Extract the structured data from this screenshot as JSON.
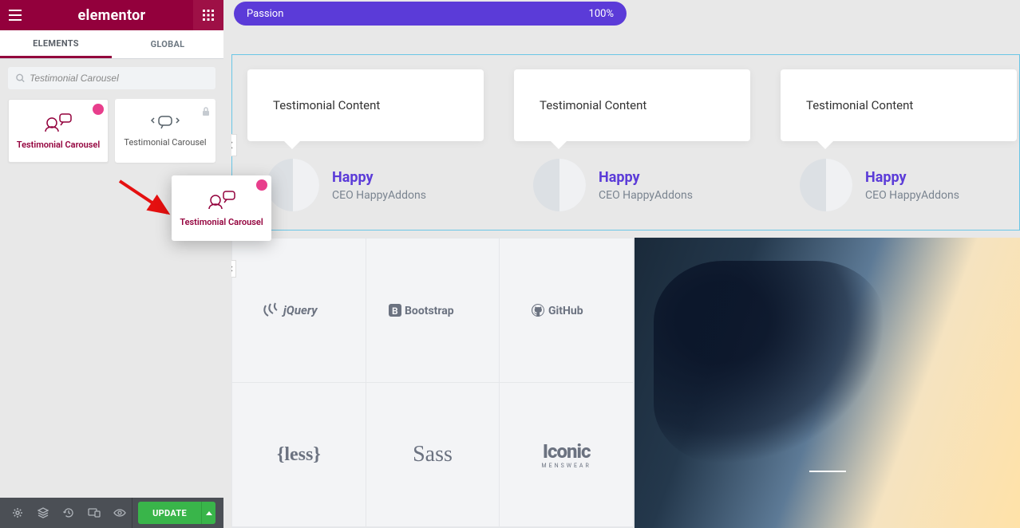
{
  "sidebar": {
    "title": "elementor",
    "tabs": {
      "elements": "ELEMENTS",
      "global": "GLOBAL"
    },
    "search": {
      "placeholder": "Testimonial Carousel",
      "value": "Testimonial Carousel"
    },
    "widgets": [
      {
        "label": "Testimonial Carousel"
      },
      {
        "label": "Testimonial Carousel"
      }
    ],
    "dragging": {
      "label": "Testimonial Carousel"
    }
  },
  "footer": {
    "update": "UPDATE"
  },
  "preview": {
    "progress": {
      "label": "Passion",
      "value": "100%"
    },
    "testimonials": [
      {
        "content": "Testimonial Content",
        "name": "Happy",
        "role": "CEO HappyAddons"
      },
      {
        "content": "Testimonial Content",
        "name": "Happy",
        "role": "CEO HappyAddons"
      },
      {
        "content": "Testimonial Content",
        "name": "Happy",
        "role": "CEO HappyAddons"
      }
    ],
    "logos": [
      "jQuery",
      "Bootstrap",
      "GitHub",
      "{less}",
      "Sass",
      "Iconic"
    ],
    "logos_sub": [
      "",
      "",
      "",
      "",
      "",
      "MENSWEAR"
    ]
  }
}
